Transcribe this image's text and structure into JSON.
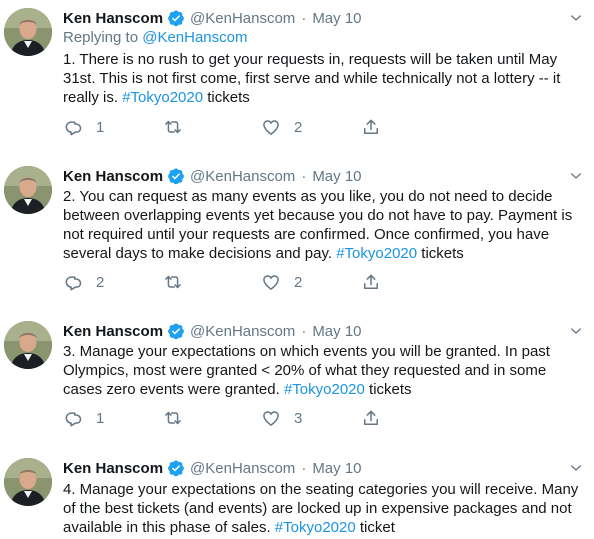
{
  "tweets": [
    {
      "name": "Ken Hanscom",
      "handle": "@KenHanscom",
      "date": "May 10",
      "replying_prefix": "Replying to ",
      "replying_handle": "@KenHanscom",
      "text": "1.  There is no rush to get your requests in, requests will be taken until May 31st. This is not first come, first serve and while technically not a lottery -- it really is. ",
      "hashtag": "#Tokyo2020",
      "suffix": " tickets",
      "replies": "1",
      "retweets": "",
      "likes": "2"
    },
    {
      "name": "Ken Hanscom",
      "handle": "@KenHanscom",
      "date": "May 10",
      "text": "2.  You can request as many events as you like, you do not need to decide between overlapping events yet because you do not have to pay. Payment is not required until your requests are confirmed. Once confirmed, you have several days to make decisions and pay. ",
      "hashtag": "#Tokyo2020",
      "suffix": " tickets",
      "replies": "2",
      "retweets": "",
      "likes": "2"
    },
    {
      "name": "Ken Hanscom",
      "handle": "@KenHanscom",
      "date": "May 10",
      "text": "3. Manage your expectations on which events you will be granted. In past Olympics, most were granted < 20% of what they requested and in some cases zero events were granted. ",
      "hashtag": "#Tokyo2020",
      "suffix": " tickets",
      "replies": "1",
      "retweets": "",
      "likes": "3"
    },
    {
      "name": "Ken Hanscom",
      "handle": "@KenHanscom",
      "date": "May 10",
      "text": "4. Manage your expectations on the seating categories you will receive. Many of the best tickets (and events) are locked up in expensive packages and not available in this phase of sales. ",
      "hashtag": "#Tokyo2020",
      "suffix": " ticket"
    }
  ],
  "icons": {
    "verified": "verified-badge-icon",
    "caret": "chevron-down-icon",
    "reply": "reply-icon",
    "retweet": "retweet-icon",
    "like": "heart-icon",
    "share": "share-icon"
  },
  "colors": {
    "link": "#1b95e0",
    "secondary": "#657786",
    "verified": "#1da1f2"
  }
}
